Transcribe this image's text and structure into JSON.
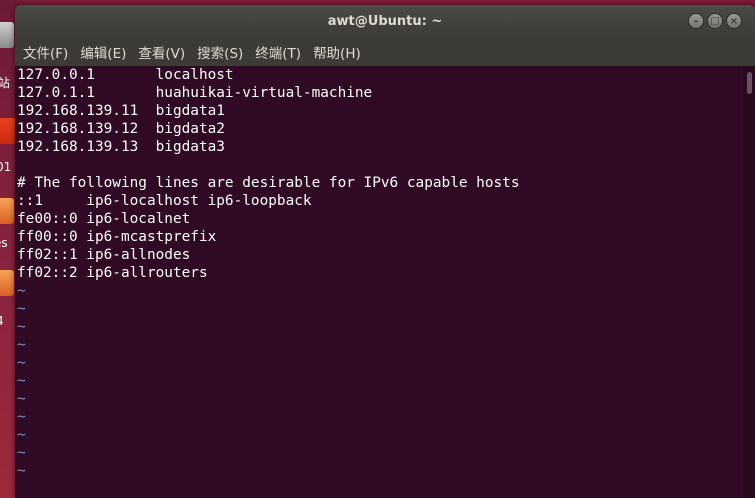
{
  "desktop": {
    "labels": [
      "站",
      "01",
      "es",
      "4"
    ]
  },
  "window": {
    "title": "awt@Ubuntu: ~",
    "controls": {
      "minimize": "–",
      "maximize": "□",
      "close": "×"
    }
  },
  "menu": {
    "items": [
      {
        "label": "文件(F)"
      },
      {
        "label": "编辑(E)"
      },
      {
        "label": "查看(V)"
      },
      {
        "label": "搜索(S)"
      },
      {
        "label": "终端(T)"
      },
      {
        "label": "帮助(H)"
      }
    ]
  },
  "terminal": {
    "lines": [
      "127.0.0.1       localhost",
      "127.0.1.1       huahuikai-virtual-machine",
      "192.168.139.11  bigdata1",
      "192.168.139.12  bigdata2",
      "192.168.139.13  bigdata3",
      "",
      "# The following lines are desirable for IPv6 capable hosts",
      "::1     ip6-localhost ip6-loopback",
      "fe00::0 ip6-localnet",
      "ff00::0 ip6-mcastprefix",
      "ff02::1 ip6-allnodes",
      "ff02::2 ip6-allrouters"
    ],
    "tilde": "~",
    "tilde_count": 11
  },
  "colors": {
    "terminal_bg": "#300a24",
    "tilde": "#7a8fd2",
    "titlebar": "#3c3b37"
  }
}
